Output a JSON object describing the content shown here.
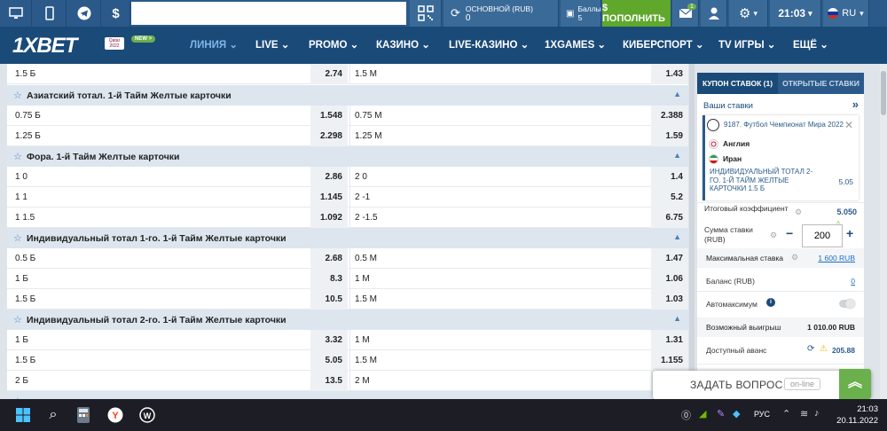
{
  "topbar": {
    "account_label": "ОСНОВНОЙ (RUB)",
    "account_value": "0",
    "bonus_label": "Баллы",
    "bonus_value": "5",
    "deposit_label": "$ ПОПОЛНИТЬ",
    "message_badge": "1",
    "time": "21:03",
    "lang": "RU",
    "search_placeholder": ""
  },
  "logo": {
    "brand": "1XBET",
    "qatar": "Qatar 2022",
    "new_badge": "NEW >"
  },
  "nav": {
    "items": [
      {
        "label": "ЛИНИЯ ⌄"
      },
      {
        "label": "LIVE ⌄"
      },
      {
        "label": "PROMO ⌄"
      },
      {
        "label": "КАЗИНО ⌄"
      },
      {
        "label": "LIVE-КАЗИНО ⌄"
      },
      {
        "label": "1XGAMES ⌄"
      },
      {
        "label": "КИБЕРСПОРТ ⌄"
      },
      {
        "label": "TV ИГРЫ ⌄"
      },
      {
        "label": "ЕЩЁ ⌄"
      }
    ]
  },
  "markets": {
    "r0": {
      "l1": "1.5 Б",
      "o1": "2.74",
      "l2": "1.5 М",
      "o2": "1.43"
    },
    "h1": "Азиатский тотал. 1-й Тайм Желтые карточки",
    "r1": {
      "l1": "0.75 Б",
      "o1": "1.548",
      "l2": "0.75 М",
      "o2": "2.388"
    },
    "r2": {
      "l1": "1.25 Б",
      "o1": "2.298",
      "l2": "1.25 М",
      "o2": "1.59"
    },
    "h2": "Фора. 1-й Тайм Желтые карточки",
    "r3": {
      "l1": "1 0",
      "o1": "2.86",
      "l2": "2 0",
      "o2": "1.4"
    },
    "r4": {
      "l1": "1 1",
      "o1": "1.145",
      "l2": "2 -1",
      "o2": "5.2"
    },
    "r5": {
      "l1": "1 1.5",
      "o1": "1.092",
      "l2": "2 -1.5",
      "o2": "6.75"
    },
    "h3": "Индивидуальный тотал 1-го. 1-й Тайм Желтые карточки",
    "r6": {
      "l1": "0.5 Б",
      "o1": "2.68",
      "l2": "0.5 М",
      "o2": "1.47"
    },
    "r7": {
      "l1": "1 Б",
      "o1": "8.3",
      "l2": "1 М",
      "o2": "1.06"
    },
    "r8": {
      "l1": "1.5 Б",
      "o1": "10.5",
      "l2": "1.5 М",
      "o2": "1.03"
    },
    "h4": "Индивидуальный тотал 2-го. 1-й Тайм Желтые карточки",
    "r9": {
      "l1": "1 Б",
      "o1": "3.32",
      "l2": "1 М",
      "o2": "1.31"
    },
    "r10": {
      "l1": "1.5 Б",
      "o1": "5.05",
      "l2": "1.5 М",
      "o2": "1.155"
    },
    "r11": {
      "l1": "2 Б",
      "o1": "13.5",
      "l2": "2 М",
      "o2": ""
    }
  },
  "coupon": {
    "tab_coupon": "КУПОН СТАВОК (1)",
    "tab_open": "ОТКРЫТЫЕ СТАВКИ",
    "your_bets": "Ваши ставки",
    "event": "9187. Футбол Чемпионат Мира 2022",
    "team1": "Англия",
    "team2": "Иран",
    "market": "ИНДИВИДУАЛЬНЫЙ ТОТАЛ 2-ГО. 1-Й ТАЙМ ЖЕЛТЫЕ КАРТОЧКИ 1.5 Б",
    "odd": "5.05",
    "total_label": "Итоговый коэффициент",
    "total_value": "5.050",
    "stake_label": "Сумма ставки (RUB)",
    "stake_value": "200",
    "max_label": "Максимальная ставка",
    "max_value": "1 600 RUB",
    "balance_label": "Баланс (RUB)",
    "balance_value": "0",
    "auto_label": "Автомаксимум",
    "win_label": "Возможный выигрыш",
    "win_value": "1 010.00 RUB",
    "advance_label": "Доступный аванс",
    "advance_value": "205.88"
  },
  "ask": {
    "label": "ЗАДАТЬ ВОПРОС",
    "status": "on-line"
  },
  "taskbar": {
    "lang": "РУС",
    "time": "21:03",
    "date": "20.11.2022"
  }
}
